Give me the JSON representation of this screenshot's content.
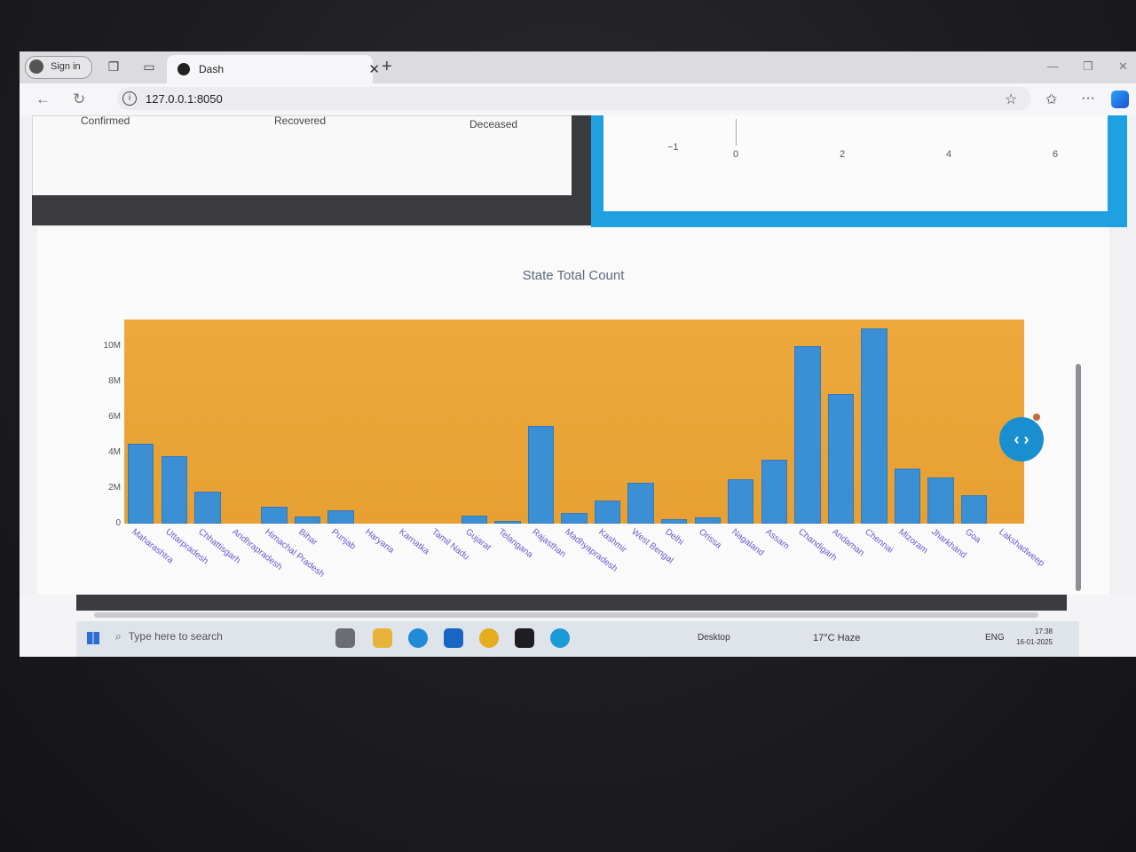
{
  "browser": {
    "signin_label": "Sign in",
    "tab_title": "Dash",
    "url": "127.0.0.1:8050"
  },
  "stats": {
    "confirmed_label": "Confirmed",
    "recovered_label": "Recovered",
    "deceased_label": "Deceased"
  },
  "mini_axis": {
    "ticks": [
      "−1",
      "0",
      "2",
      "4",
      "6"
    ]
  },
  "chart_data": {
    "type": "bar",
    "title": "State Total Count",
    "xlabel": "",
    "ylabel": "",
    "ylim": [
      0,
      11500000
    ],
    "ytick_labels": [
      "0",
      "2M",
      "4M",
      "6M",
      "8M",
      "10M"
    ],
    "yticks": [
      0,
      2000000,
      4000000,
      6000000,
      8000000,
      10000000
    ],
    "categories": [
      "Maharashtra",
      "Uttarpradesh",
      "Chhattisgarh",
      "Andhrapradesh",
      "Himachal Pradesh",
      "Bihar",
      "Punjab",
      "Haryana",
      "Karnatka",
      "Tamil Nadu",
      "Gujarat",
      "Telangana",
      "Rajasthan",
      "Madhyapradesh",
      "Kashmir",
      "West Bengal",
      "Delhi",
      "Orissa",
      "Nagaland",
      "Assam",
      "Chandigarh",
      "Andaman",
      "Chennai",
      "Mizoram",
      "Jharkhand",
      "Goa",
      "Lakshadweep"
    ],
    "values": [
      4500000,
      3800000,
      1800000,
      0,
      950000,
      400000,
      750000,
      0,
      0,
      0,
      450000,
      150000,
      5500000,
      600000,
      1300000,
      2300000,
      250000,
      350000,
      2500000,
      3600000,
      10000000,
      7300000,
      11000000,
      3100000,
      2600000,
      1600000,
      0
    ],
    "bar_color": "#3b8fd4",
    "plot_bg": "#eba535",
    "grid": false
  },
  "taskbar": {
    "search_placeholder": "Type here to search",
    "desktop_label": "Desktop",
    "weather": "17°C  Haze",
    "lang": "ENG",
    "time": "17:38",
    "date": "16-01-2025"
  }
}
